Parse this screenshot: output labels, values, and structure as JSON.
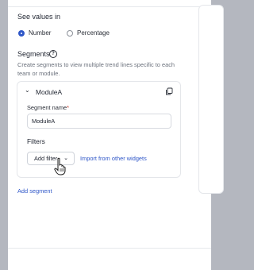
{
  "see_values": {
    "title": "See values in",
    "options": [
      {
        "label": "Number",
        "selected": true
      },
      {
        "label": "Percentage",
        "selected": false
      }
    ]
  },
  "segments": {
    "title": "Segments",
    "help_icon": "question-circle-icon",
    "description_line1": "Create segments to view multiple trend lines specific to each",
    "description_line2": "team or module.",
    "items": [
      {
        "name": "ModuleA",
        "name_label": "Segment name",
        "required_mark": "*",
        "name_value": "ModuleA",
        "filters_title": "Filters",
        "add_filter_label": "Add filter",
        "import_link": "Import from other widgets"
      }
    ],
    "add_segment_label": "Add segment"
  },
  "colors": {
    "accent": "#2f57c8",
    "backdrop": "#b4b7bf"
  }
}
